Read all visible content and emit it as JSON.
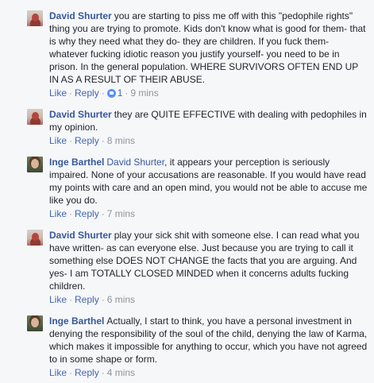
{
  "comments": [
    {
      "author": "David Shurter",
      "avatar_icon": "profile-photo-david",
      "mention": "",
      "text": "you are starting to piss me off with this \"pedophile rights\" thing you are trying to promote. Kids don't know what is good for them- that is why they need what they do- they are children. If you fuck them- whatever fucking idiotic reason you justify yourself- you need to be in prison. In the general population. WHERE SURVIVORS OFTEN END UP IN AS A RESULT OF THEIR ABUSE.",
      "like_label": "Like",
      "reply_label": "Reply",
      "reaction_count": "1",
      "time": "9 mins"
    },
    {
      "author": "David Shurter",
      "avatar_icon": "profile-photo-david",
      "mention": "",
      "text": "they are QUITE EFFECTIVE with dealing with pedophiles in my opinion.",
      "like_label": "Like",
      "reply_label": "Reply",
      "reaction_count": "",
      "time": "8 mins"
    },
    {
      "author": "Inge Barthel",
      "avatar_icon": "profile-photo-inge",
      "mention": "David Shurter",
      "text": ", it appears your perception is seriously impaired. None of your accusations are reasonable. If you would have read my points with care and an open mind, you would not be able to accuse me like you do.",
      "like_label": "Like",
      "reply_label": "Reply",
      "reaction_count": "",
      "time": "7 mins"
    },
    {
      "author": "David Shurter",
      "avatar_icon": "profile-photo-david",
      "mention": "",
      "text": "play your sick shit with someone else. I can read what you have written- as can everyone else. Just because you are trying to call it something else DOES NOT CHANGE the facts that you are arguing. And yes- I am TOTALLY CLOSED MINDED when it concerns adults fucking children.",
      "like_label": "Like",
      "reply_label": "Reply",
      "reaction_count": "",
      "time": "6 mins"
    },
    {
      "author": "Inge Barthel",
      "avatar_icon": "profile-photo-inge",
      "mention": "",
      "text": "Actually, I start to think, you have a personal investment in denying the responsibility of the soul of the child, denying the law of Karma, which makes it impossible for anything to occur, which you have not agreed to in some shape or form.",
      "like_label": "Like",
      "reply_label": "Reply",
      "reaction_count": "",
      "time": "4 mins"
    }
  ],
  "colors": {
    "name_link": "#365899",
    "action_link": "#4267b2",
    "meta_gray": "#90949c",
    "background": "#f6f7f9",
    "like_badge": "#5890ff"
  }
}
